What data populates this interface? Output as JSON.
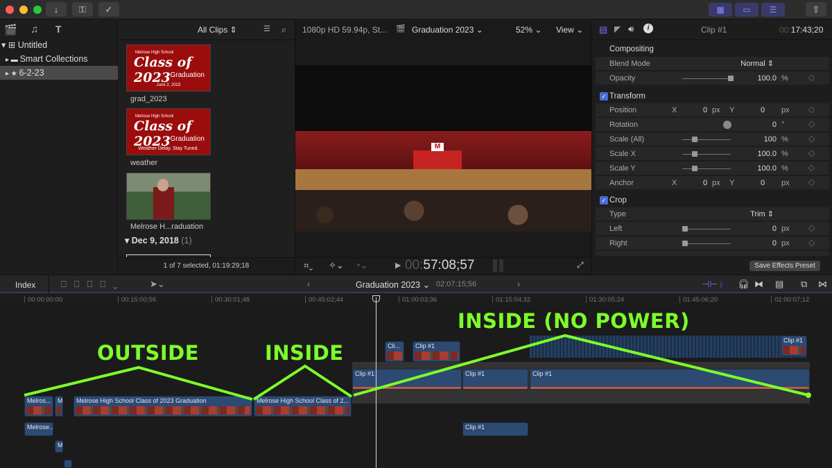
{
  "titlebar": {
    "buttons": [
      "download-icon",
      "key-icon",
      "check-circle-icon"
    ]
  },
  "libraries": {
    "items": [
      {
        "label": "Untitled"
      },
      {
        "label": "Smart Collections"
      },
      {
        "label": "6-2-23"
      }
    ]
  },
  "browser": {
    "filter": "All Clips",
    "clips": [
      {
        "title": "grad_2023",
        "school": "Melrose High School",
        "class": "Class of 2023",
        "sub": "Graduation",
        "date": "June 2, 2023"
      },
      {
        "title": "weather",
        "school": "Melrose High School",
        "class": "Class of 2023",
        "sub": "Graduation",
        "date": "Weather Delay.  Stay Tuned."
      },
      {
        "title": "Melrose H...raduation"
      }
    ],
    "group": {
      "label": "Dec 9, 2018",
      "count": "(1)"
    },
    "status": "1 of 7 selected, 01:19:29;18"
  },
  "viewer": {
    "format": "1080p HD 59.94p, St...",
    "title": "Graduation 2023",
    "zoom": "52%",
    "view": "View",
    "timecode_dim": "00:",
    "timecode": "57:08;57"
  },
  "inspector": {
    "clip": "Clip #1",
    "timecode_dim": "00:",
    "timecode": "17:43;20",
    "compositing": {
      "title": "Compositing",
      "blend_label": "Blend Mode",
      "blend": "Normal",
      "opacity_label": "Opacity",
      "opacity": "100.0",
      "opacity_unit": "%"
    },
    "transform": {
      "title": "Transform",
      "rows": [
        {
          "label": "Position",
          "x": "0",
          "xu": "px",
          "y": "0",
          "yu": "px"
        },
        {
          "label": "Rotation",
          "value": "0",
          "unit": "°"
        },
        {
          "label": "Scale (All)",
          "value": "100",
          "unit": "%"
        },
        {
          "label": "Scale X",
          "value": "100.0",
          "unit": "%"
        },
        {
          "label": "Scale Y",
          "value": "100.0",
          "unit": "%"
        },
        {
          "label": "Anchor",
          "x": "0",
          "xu": "px",
          "y": "0",
          "yu": "px"
        }
      ]
    },
    "crop": {
      "title": "Crop",
      "type_label": "Type",
      "type": "Trim",
      "rows": [
        {
          "label": "Left",
          "value": "0",
          "unit": "px"
        },
        {
          "label": "Right",
          "value": "0",
          "unit": "px"
        }
      ]
    },
    "save_preset": "Save Effects Preset"
  },
  "timeline": {
    "index": "Index",
    "project": "Graduation 2023",
    "duration": "02:07:15;56",
    "ruler": [
      "00:00:00;00",
      "00:15:00;56",
      "00:30:01;48",
      "00:45:02;44",
      "01:00:03;36",
      "01:15:04;32",
      "01:30:05;24",
      "01:45:06;20",
      "02:00:07;12"
    ],
    "clips": [
      "Melros...",
      "M",
      "Melrose High School Class of 2023 Graduation",
      "Melrose High School Class of 2...",
      "Clip #1",
      "Clip #1",
      "Clip #1",
      "Clip #1",
      "Cli...",
      "Clip #1",
      "Clip #1",
      "Melrose...",
      "M"
    ]
  },
  "annotations": [
    "OUTSIDE",
    "INSIDE",
    "INSIDE (NO POWER)"
  ],
  "colors": {
    "annotation": "#7dff2a",
    "accent": "#4a6bd6",
    "clip": "#2d4a72"
  }
}
